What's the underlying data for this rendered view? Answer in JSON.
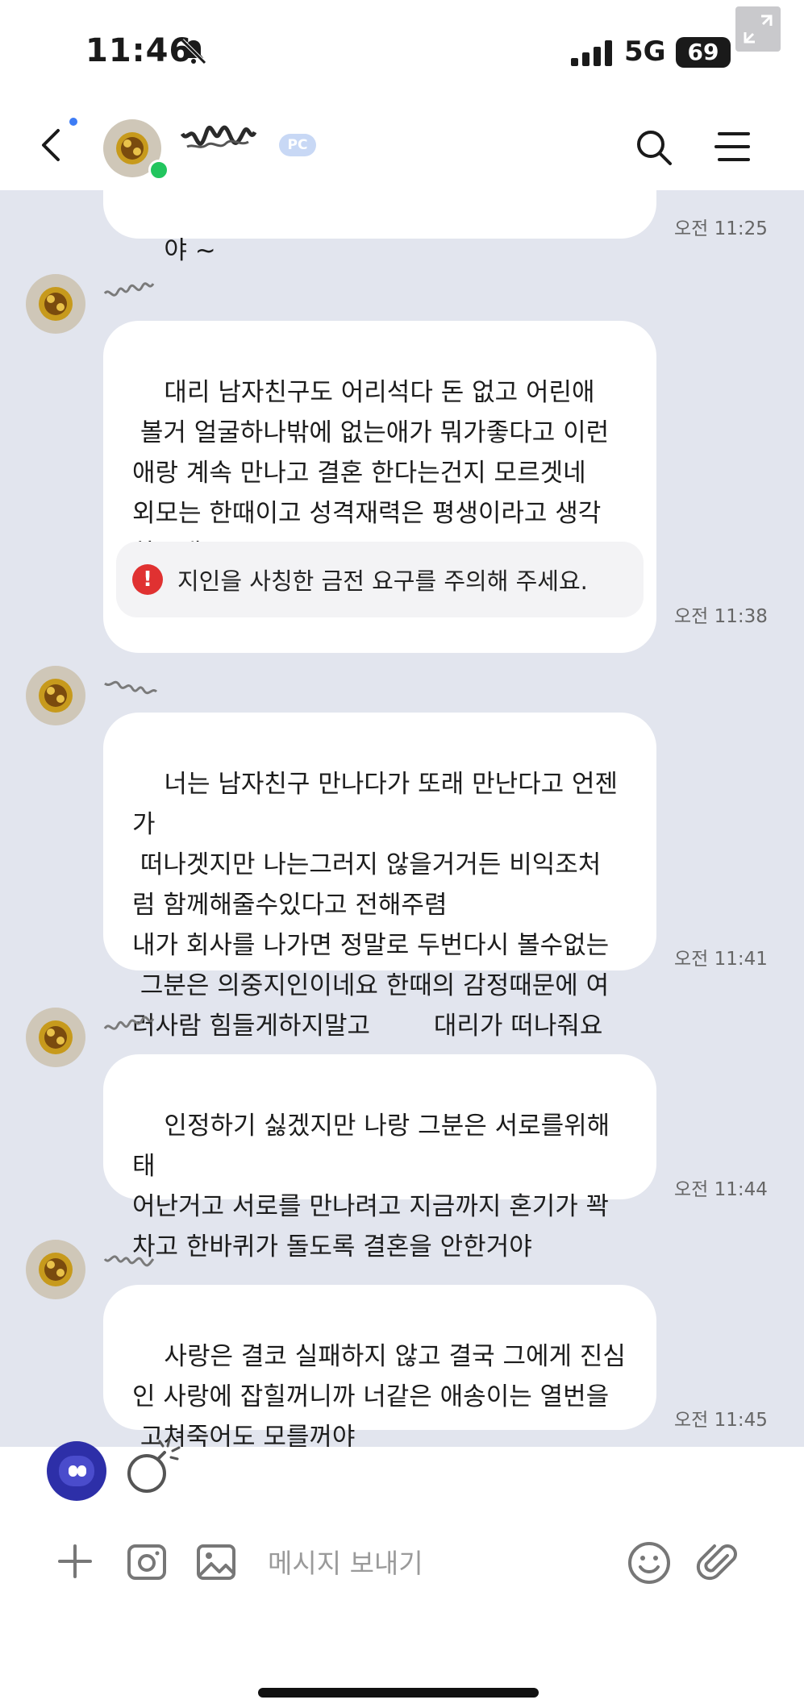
{
  "status": {
    "time": "11:46",
    "network": "5G",
    "battery": "69"
  },
  "header": {
    "badge": "PC"
  },
  "chat": {
    "partial_message": "야 ~",
    "messages": [
      {
        "text": "대리 남자친구도 어리석다 돈 없고 어린애\n 볼거 얼굴하나밖에 없는애가 뭐가좋다고 이런\n애랑 계속 만나고 결혼 한다는건지 모르겟네\n외모는 한때이고 성격재력은 평생이라고 생각\n하는대",
        "time": "오전 11:38"
      },
      {
        "text": "너는 남자친구 만나다가 또래 만난다고 언젠가\n 떠나겟지만 나는그러지 않을거거든 비익조처\n럼 함께해줄수있다고 전해주렴\n내가 회사를 나가면 정말로 두번다시 볼수없는\n 그분은 의중지인이네요 한때의 감정때문에 여\n러사람 힘들게하지말고        대리가 떠나줘요",
        "time": "오전 11:41"
      },
      {
        "text": "인정하기 싫겠지만 나랑 그분은 서로를위해 태\n어난거고 서로를 만나려고 지금까지 혼기가 꽉\n차고 한바퀴가 돌도록 결혼을 안한거야",
        "time": "오전 11:44"
      },
      {
        "text": "사랑은 결코 실패하지 않고 결국 그에게 진심\n인 사랑에 잡힐꺼니까 너같은 애송이는 열번을\n 고쳐죽어도 모를꺼야",
        "time": "오전 11:45"
      }
    ],
    "first_time": "오전 11:25",
    "warning": "지인을 사칭한 금전 요구를 주의해 주세요."
  },
  "input": {
    "placeholder": "메시지 보내기"
  },
  "icons": {
    "back": "chevron-left-icon",
    "search": "search-icon",
    "menu": "menu-icon",
    "plus": "plus-icon",
    "camera": "camera-icon",
    "image": "image-icon",
    "emoji": "emoji-icon",
    "attach": "paperclip-icon",
    "bomb": "bomb-icon"
  },
  "colors": {
    "chat_bg": "#e2e5ee",
    "bubble": "#ffffff",
    "online": "#22c55e",
    "warning": "#e03131",
    "badge": "#c8d8f5"
  }
}
